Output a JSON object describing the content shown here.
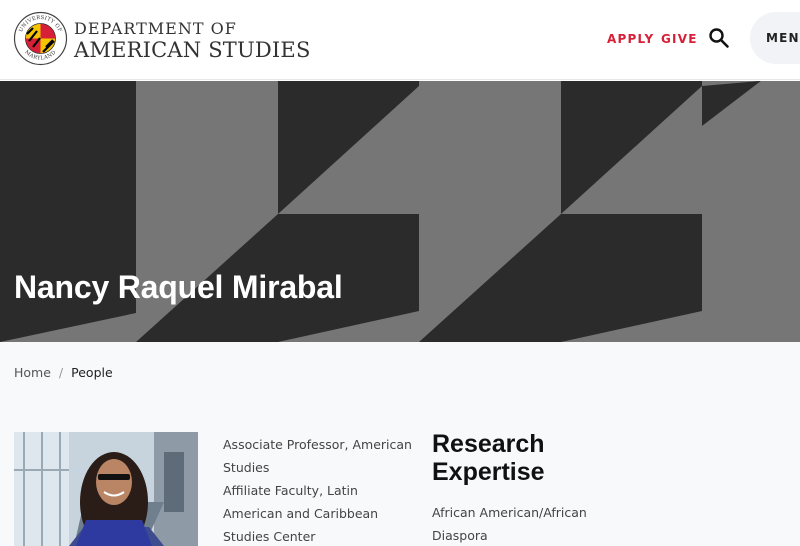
{
  "header": {
    "dept_line1": "DEPARTMENT OF",
    "dept_line2": "AMERICAN STUDIES",
    "seal_text_top": "UNIVERSITY OF",
    "seal_text_bottom": "MARYLAND",
    "nav": {
      "apply": "APPLY",
      "give": "GIVE",
      "menu": "MENU"
    },
    "icons": {
      "search": "search-icon"
    },
    "accent_color": "#d71f37"
  },
  "hero": {
    "title": "Nancy Raquel Mirabal",
    "colors": {
      "dark": "#2b2b2b",
      "light": "#767676"
    }
  },
  "breadcrumb": {
    "home": "Home",
    "separator": "/",
    "current": "People"
  },
  "profile": {
    "title_1": "Associate Professor, American Studies",
    "title_2": "Affiliate Faculty, Latin American and Caribbean Studies Center",
    "research_heading": "Research Expertise",
    "research_item_1": "African American/African Diaspora"
  }
}
